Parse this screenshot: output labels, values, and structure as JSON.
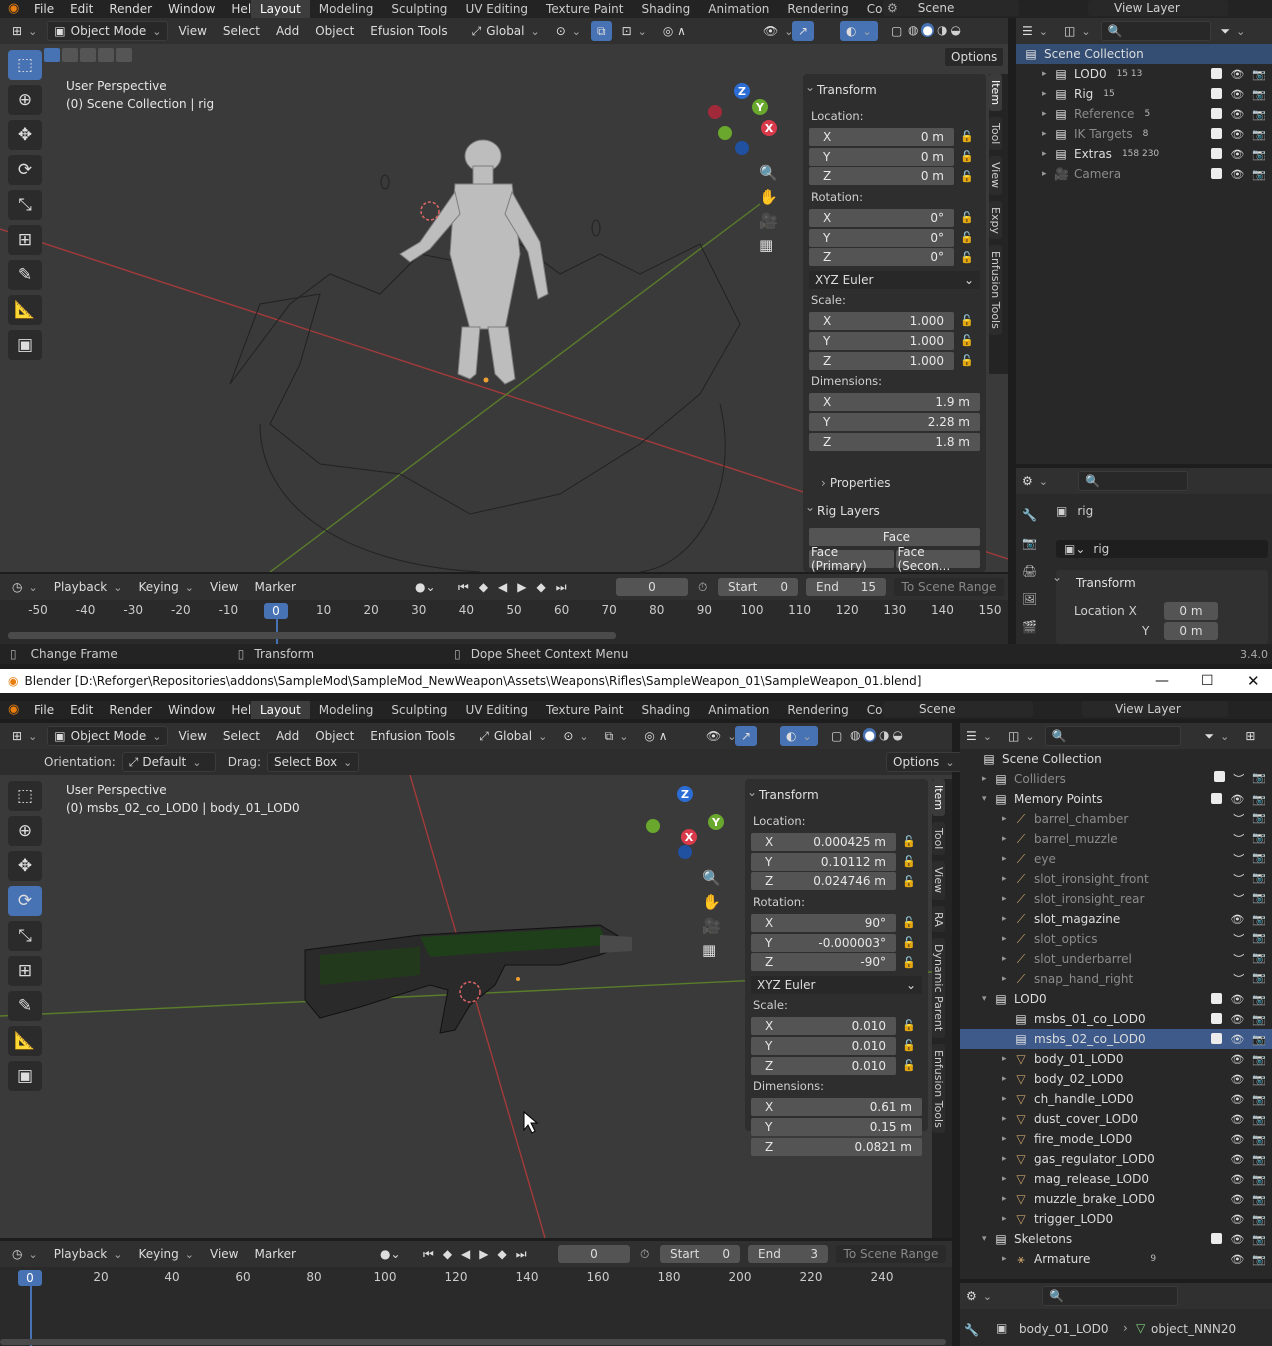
{
  "top": {
    "menus": [
      "File",
      "Edit",
      "Render",
      "Window",
      "Help"
    ],
    "workspaces": [
      "Layout",
      "Modeling",
      "Sculpting",
      "UV Editing",
      "Texture Paint",
      "Shading",
      "Animation",
      "Rendering",
      "Compositing"
    ],
    "scene": "Scene",
    "view_layer": "View Layer",
    "header": {
      "mode": "Object Mode",
      "menus": [
        "View",
        "Select",
        "Add",
        "Object",
        "Efusion Tools"
      ],
      "transform": "Global",
      "options": "Options"
    },
    "viewport": {
      "perspective": "User Perspective",
      "context": "(0) Scene Collection | rig"
    },
    "npanel": {
      "title": "Transform",
      "location_label": "Location:",
      "location": [
        "0 m",
        "0 m",
        "0 m"
      ],
      "rotation_label": "Rotation:",
      "rotation": [
        "0°",
        "0°",
        "0°"
      ],
      "rotation_mode": "XYZ Euler",
      "scale_label": "Scale:",
      "scale": [
        "1.000",
        "1.000",
        "1.000"
      ],
      "dimensions_label": "Dimensions:",
      "dimensions": [
        "1.9 m",
        "2.28 m",
        "1.8 m"
      ],
      "axes": [
        "X",
        "Y",
        "Z"
      ],
      "properties": "Properties",
      "rig_layers": "Rig Layers",
      "face": "Face",
      "face_primary": "Face (Primary)",
      "face_secondary": "Face (Secon..."
    },
    "tabs": [
      "Item",
      "Tool",
      "View",
      "Expy",
      "Enfusion Tools"
    ],
    "outliner": {
      "root": "Scene Collection",
      "rows": [
        {
          "name": "LOD0",
          "extra": "15  13"
        },
        {
          "name": "Rig",
          "extra": "15"
        },
        {
          "name": "Reference",
          "extra": "5"
        },
        {
          "name": "IK Targets",
          "extra": "8"
        },
        {
          "name": "Extras",
          "extra": "158 230"
        },
        {
          "name": "Camera",
          "extra": ""
        }
      ]
    },
    "props": {
      "object": "rig",
      "data": "rig",
      "section": "Transform",
      "loc_x_label": "Location X",
      "loc_y_label": "Y",
      "loc_x": "0 m",
      "loc_y": "0 m"
    },
    "timeline": {
      "menus": [
        "Playback",
        "Keying",
        "View",
        "Marker"
      ],
      "frame": "0",
      "start_label": "Start",
      "start": "0",
      "end_label": "End",
      "end": "15",
      "range": "To Scene Range",
      "ticks": [
        "-50",
        "-40",
        "-30",
        "-20",
        "-10",
        "0",
        "10",
        "20",
        "30",
        "40",
        "50",
        "60",
        "70",
        "80",
        "90",
        "100",
        "110",
        "120",
        "130",
        "140",
        "150"
      ],
      "current": "0"
    },
    "status": {
      "a": "Change Frame",
      "b": "Transform",
      "c": "Dope Sheet Context Menu",
      "version": "3.4.0"
    }
  },
  "bottom": {
    "window_title": "Blender [D:\\Reforger\\Repositories\\addons\\SampleMod\\SampleMod_NewWeapon\\Assets\\Weapons\\Rifles\\SampleWeapon_01\\SampleWeapon_01.blend]",
    "menus": [
      "File",
      "Edit",
      "Render",
      "Window",
      "Help"
    ],
    "workspaces": [
      "Layout",
      "Modeling",
      "Sculpting",
      "UV Editing",
      "Texture Paint",
      "Shading",
      "Animation",
      "Rendering",
      "Compositing"
    ],
    "scene": "Scene",
    "view_layer": "View Layer",
    "header": {
      "mode": "Object Mode",
      "menus": [
        "View",
        "Select",
        "Add",
        "Object",
        "Enfusion Tools"
      ],
      "transform": "Global",
      "orientation_label": "Orientation:",
      "orientation": "Default",
      "drag_label": "Drag:",
      "drag": "Select Box",
      "options": "Options"
    },
    "viewport": {
      "perspective": "User Perspective",
      "context": "(0) msbs_02_co_LOD0 | body_01_LOD0"
    },
    "npanel": {
      "title": "Transform",
      "location_label": "Location:",
      "location": [
        "0.000425 m",
        "0.10112 m",
        "0.024746 m"
      ],
      "rotation_label": "Rotation:",
      "rotation": [
        "90°",
        "-0.000003°",
        "-90°"
      ],
      "rotation_mode": "XYZ Euler",
      "scale_label": "Scale:",
      "scale": [
        "0.010",
        "0.010",
        "0.010"
      ],
      "dimensions_label": "Dimensions:",
      "dimensions": [
        "0.61 m",
        "0.15 m",
        "0.0821 m"
      ],
      "axes": [
        "X",
        "Y",
        "Z"
      ]
    },
    "tabs": [
      "Item",
      "Tool",
      "View",
      "RA",
      "Dynamic Parent",
      "Enfusion Tools"
    ],
    "outliner": {
      "root": "Scene Collection",
      "rows": [
        {
          "name": "Colliders",
          "kind": "coll",
          "level": 1,
          "dim": true
        },
        {
          "name": "Memory Points",
          "kind": "coll",
          "level": 1,
          "open": true
        },
        {
          "name": "barrel_chamber",
          "kind": "bone",
          "level": 2,
          "dim": true
        },
        {
          "name": "barrel_muzzle",
          "kind": "bone",
          "level": 2,
          "dim": true
        },
        {
          "name": "eye",
          "kind": "bone",
          "level": 2,
          "dim": true
        },
        {
          "name": "slot_ironsight_front",
          "kind": "bone",
          "level": 2,
          "dim": true
        },
        {
          "name": "slot_ironsight_rear",
          "kind": "bone",
          "level": 2,
          "dim": true
        },
        {
          "name": "slot_magazine",
          "kind": "bone",
          "level": 2
        },
        {
          "name": "slot_optics",
          "kind": "bone",
          "level": 2,
          "dim": true
        },
        {
          "name": "slot_underbarrel",
          "kind": "bone",
          "level": 2,
          "dim": true
        },
        {
          "name": "snap_hand_right",
          "kind": "bone",
          "level": 2,
          "dim": true
        },
        {
          "name": "LOD0",
          "kind": "coll",
          "level": 1,
          "open": true
        },
        {
          "name": "msbs_01_co_LOD0",
          "kind": "coll",
          "level": 2
        },
        {
          "name": "msbs_02_co_LOD0",
          "kind": "coll",
          "level": 2,
          "hl": true
        },
        {
          "name": "body_01_LOD0",
          "kind": "mesh",
          "level": 2
        },
        {
          "name": "body_02_LOD0",
          "kind": "mesh",
          "level": 2
        },
        {
          "name": "ch_handle_LOD0",
          "kind": "mesh",
          "level": 2
        },
        {
          "name": "dust_cover_LOD0",
          "kind": "mesh",
          "level": 2
        },
        {
          "name": "fire_mode_LOD0",
          "kind": "mesh",
          "level": 2
        },
        {
          "name": "gas_regulator_LOD0",
          "kind": "mesh",
          "level": 2
        },
        {
          "name": "mag_release_LOD0",
          "kind": "mesh",
          "level": 2
        },
        {
          "name": "muzzle_brake_LOD0",
          "kind": "mesh",
          "level": 2
        },
        {
          "name": "trigger_LOD0",
          "kind": "mesh",
          "level": 2
        },
        {
          "name": "Skeletons",
          "kind": "coll",
          "level": 1,
          "open": true
        },
        {
          "name": "Armature",
          "kind": "arm",
          "level": 2,
          "extra": "9"
        }
      ]
    },
    "props": {
      "object": "body_01_LOD0",
      "data": "object_NNN20"
    },
    "timeline": {
      "menus": [
        "Playback",
        "Keying",
        "View",
        "Marker"
      ],
      "frame": "0",
      "start_label": "Start",
      "start": "0",
      "end_label": "End",
      "end": "3",
      "range": "To Scene Range",
      "ticks": [
        "0",
        "20",
        "40",
        "60",
        "80",
        "100",
        "120",
        "140",
        "160",
        "180",
        "200",
        "220",
        "240"
      ],
      "current": "0"
    }
  }
}
